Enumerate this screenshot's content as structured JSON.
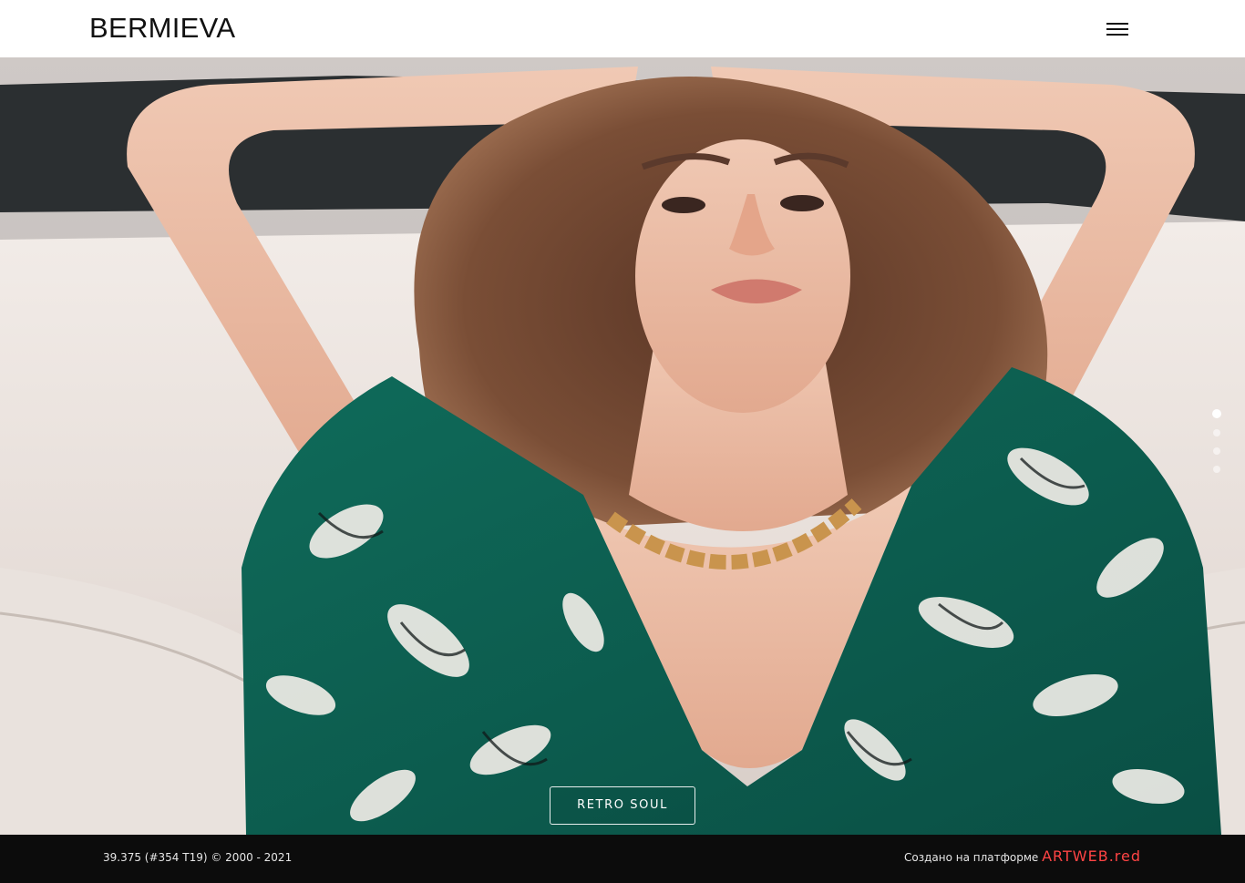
{
  "header": {
    "logo": "BERMIEVA",
    "menu_icon": "hamburger-menu-icon"
  },
  "hero": {
    "image": "model-photo",
    "cta_label": "RETRO SOUL",
    "slider": {
      "total": 4,
      "active_index": 0
    }
  },
  "footer": {
    "stats": "39.375 (#354 T19) © 2000 - 2021",
    "made_on": "Создано на платформе",
    "platform": "ARTWEB.red"
  },
  "colors": {
    "header_bg": "#ffffff",
    "footer_bg": "#0c0c0c",
    "platform_link": "#ff4444",
    "dress_green": "#0e6e5c"
  }
}
